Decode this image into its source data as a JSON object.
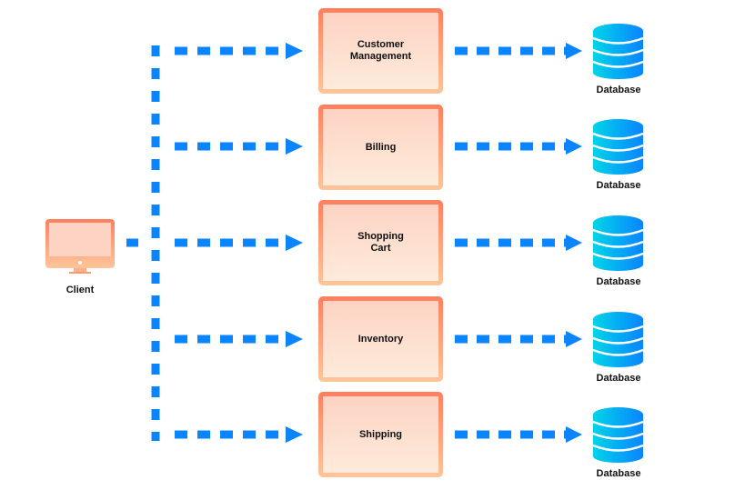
{
  "client": {
    "label": "Client",
    "icon": "monitor-icon"
  },
  "services": [
    {
      "label": "Customer\nManagement"
    },
    {
      "label": "Billing"
    },
    {
      "label": "Shopping\nCart"
    },
    {
      "label": "Inventory"
    },
    {
      "label": "Shipping"
    }
  ],
  "databases": [
    {
      "label": "Database",
      "icon": "database-icon"
    },
    {
      "label": "Database",
      "icon": "database-icon"
    },
    {
      "label": "Database",
      "icon": "database-icon"
    },
    {
      "label": "Database",
      "icon": "database-icon"
    },
    {
      "label": "Database",
      "icon": "database-icon"
    }
  ],
  "colors": {
    "arrow": "#0a84ff",
    "service_border": "#ff7f5e",
    "database": "#00b8f0"
  }
}
